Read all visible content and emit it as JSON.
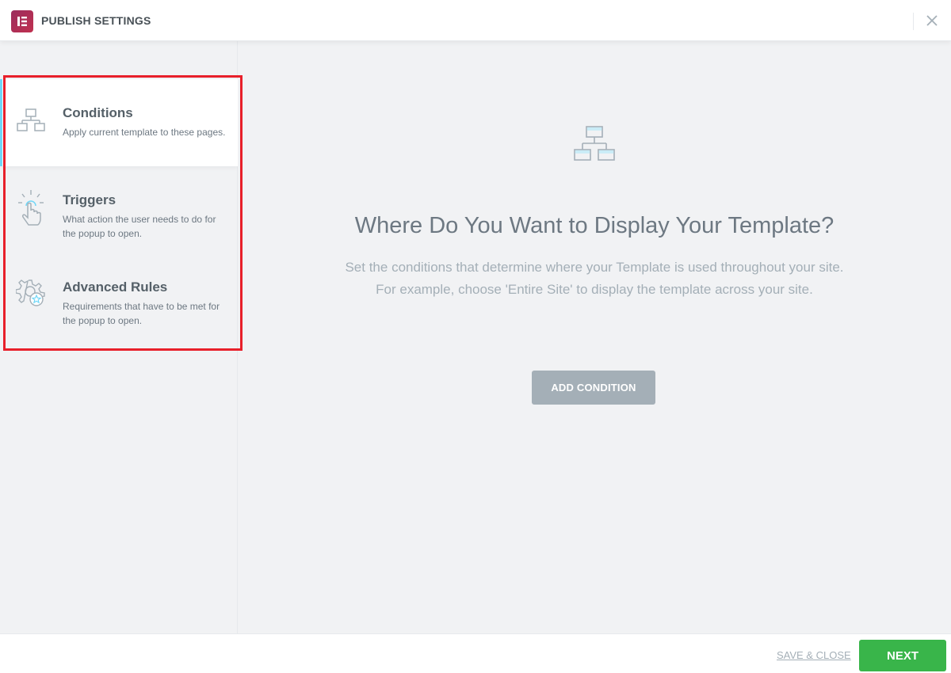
{
  "header": {
    "title": "PUBLISH SETTINGS",
    "logo_icon": "elementor-logo-icon",
    "close_icon": "close-icon"
  },
  "sidebar": {
    "items": [
      {
        "title": "Conditions",
        "description": "Apply current template to these pages.",
        "icon": "sitemap-icon",
        "active": true
      },
      {
        "title": "Triggers",
        "description": "What action the user needs to do for the popup to open.",
        "icon": "hand-pointer-icon",
        "active": false
      },
      {
        "title": "Advanced Rules",
        "description": "Requirements that have to be met for the popup to open.",
        "icon": "gear-star-icon",
        "active": false
      }
    ]
  },
  "main": {
    "icon": "sitemap-icon",
    "title": "Where Do You Want to Display Your Template?",
    "description_line1": "Set the conditions that determine where your Template is used throughout your site.",
    "description_line2": "For example, choose 'Entire Site' to display the template across your site.",
    "add_button_label": "ADD CONDITION"
  },
  "footer": {
    "save_close_label": "SAVE & CLOSE",
    "next_label": "NEXT"
  },
  "colors": {
    "brand": "#9b2d5e",
    "accent_blue": "#71d7f7",
    "next_green": "#39b54a",
    "annotation_red": "#e8202a"
  }
}
